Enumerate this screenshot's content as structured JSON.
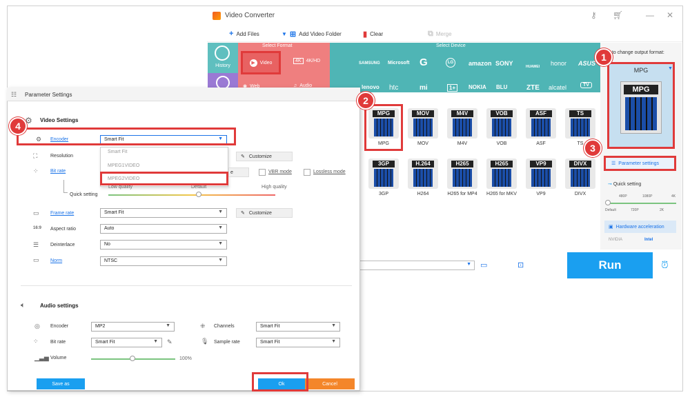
{
  "app": {
    "title": "Video Converter",
    "toolbar": {
      "add_files": "Add Files",
      "add_folder": "Add Video Folder",
      "clear": "Clear",
      "merge": "Merge"
    },
    "format_strip": {
      "select_format": "Select Format",
      "select_device": "Select Device",
      "history": "History",
      "video": "Video",
      "hd": "4K/HD",
      "web": "Web",
      "audio": "Audio",
      "brands_row1": [
        "SAMSUNG",
        "Microsoft",
        "G",
        "LG",
        "amazon",
        "SONY",
        "HUAWEI",
        "honor",
        "ASUS"
      ],
      "brands_row2": [
        "lenovo",
        "htc",
        "mi",
        "1+",
        "NOKIA",
        "BLU",
        "ZTE",
        "alcatel",
        "TV"
      ]
    },
    "formats_row1": [
      {
        "tag": "MPG",
        "label": "MPG"
      },
      {
        "tag": "MOV",
        "label": "MOV"
      },
      {
        "tag": "M4V",
        "label": "M4V"
      },
      {
        "tag": "VOB",
        "label": "VOB"
      },
      {
        "tag": "ASF",
        "label": "ASF"
      },
      {
        "tag": "TS",
        "label": "TS"
      }
    ],
    "formats_row2": [
      {
        "tag": "3GP",
        "label": "3GP"
      },
      {
        "tag": "H.264",
        "label": "H264"
      },
      {
        "tag": "H265",
        "label": "H265 for MP4"
      },
      {
        "tag": "H265",
        "label": "H265 for MKV"
      },
      {
        "tag": "VP9",
        "label": "VP9"
      },
      {
        "tag": "DIVX",
        "label": "DIVX"
      }
    ],
    "right_panel": {
      "hint": "ck to change output format:",
      "output_format": "MPG",
      "output_tag": "MPG",
      "parameter_settings": "Parameter settings",
      "quick_setting": "Quick setting",
      "ticks_top": [
        "480P",
        "1080P",
        "4K"
      ],
      "ticks_bottom": [
        "Default",
        "720P",
        "2K"
      ],
      "hardware_acceleration": "Hardware acceleration",
      "nvidia": "NVIDIA",
      "intel": "Intel"
    },
    "run": "Run"
  },
  "dialog": {
    "title": "Parameter Settings",
    "video_settings": "Video Settings",
    "encoder_label": "Encoder",
    "encoder_value": "Smart Fit",
    "encoder_options": [
      "Smart Fit",
      "MPEG1VIDEO",
      "MPEG2VIDEO"
    ],
    "resolution_label": "Resolution",
    "customize": "Customize",
    "bitrate_label": "Bit rate",
    "vbr_mode": "VBR mode",
    "lossless_mode": "Lossless mode",
    "quick_setting": "Quick setting",
    "low_quality": "Low quality",
    "default": "Default",
    "high_quality": "High quality",
    "frame_rate_label": "Frame rate",
    "frame_rate_value": "Smart Fit",
    "aspect_ratio_label": "Aspect ratio",
    "aspect_ratio_value": "Auto",
    "deinterlace_label": "Deinterlace",
    "deinterlace_value": "No",
    "norm_label": "Norm",
    "norm_value": "NTSC",
    "audio_settings": "Audio settings",
    "audio_encoder_label": "Encoder",
    "audio_encoder_value": "MP2",
    "channels_label": "Channels",
    "channels_value": "Smart Fit",
    "audio_bitrate_label": "Bit rate",
    "audio_bitrate_value": "Smart Fit",
    "sample_rate_label": "Sample rate",
    "sample_rate_value": "Smart Fit",
    "volume_label": "Volume",
    "volume_value": "100%",
    "save_as": "Save as",
    "ok": "Ok",
    "cancel": "Cancel"
  },
  "annotations": [
    "1",
    "2",
    "3",
    "4"
  ],
  "colors": {
    "accent": "#1a9ff0",
    "annotation_red": "#e03a3a",
    "teal": "#4fb5b5",
    "coral": "#ef7f7f",
    "cancel_orange": "#f4862a"
  }
}
